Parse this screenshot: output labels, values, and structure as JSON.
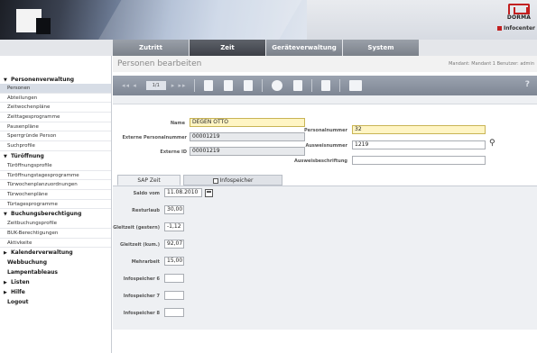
{
  "header": {
    "brand": "DORMA",
    "product": "Infocenter",
    "tabs": [
      "Zutritt",
      "Zeit",
      "Geräteverwaltung",
      "System"
    ],
    "active_tab": "Zeit"
  },
  "page": {
    "title": "Personen bearbeiten",
    "mandant": "Mandant: Mandant 1   Benutzer: admin"
  },
  "toolbar": {
    "nav_prev": "◂◂ ◂",
    "page": "1/1",
    "nav_next": "▸ ▸▸",
    "help": "?"
  },
  "sidebar": {
    "sections": [
      {
        "label": "Personenverwaltung",
        "expanded": true
      },
      {
        "label": "Türöffnung",
        "expanded": true
      },
      {
        "label": "Buchungsberechtigung",
        "expanded": true
      },
      {
        "label": "Kalenderverwaltung",
        "expanded": false
      },
      {
        "label": "Listen",
        "expanded": false
      },
      {
        "label": "Hilfe",
        "expanded": false
      }
    ],
    "personen_items": [
      "Personen",
      "Abteilungen",
      "Zeitwochenpläne",
      "Zeittagesprogramme",
      "Pausenpläne",
      "Sperrgründe Person",
      "Suchprofile"
    ],
    "tuer_items": [
      "Türöffnungsprofile",
      "Türöffnungstagesprogramme",
      "Türwochenplanzuordnungen",
      "Türwochenpläne",
      "Türtagesprogramme"
    ],
    "buchung_items": [
      "Zeitbuchungsprofile",
      "BUK-Berechtigungen",
      "Aktivkeite"
    ],
    "plain_items": [
      "Webbuchung",
      "Lampentableaus",
      "Logout"
    ]
  },
  "form": {
    "name_label": "Name",
    "name_value": "DEGEN OTTO",
    "ext_personalnummer_label": "Externe Personalnummer",
    "ext_personalnummer_value": "00001219",
    "externe_id_label": "Externe ID",
    "externe_id_value": "00001219",
    "personalnummer_label": "Personalnummer",
    "personalnummer_value": "32",
    "ausweisnummer_label": "Ausweisnummer",
    "ausweisnummer_value": "1219",
    "ausweisbeschriftung_label": "Ausweisbeschriftung",
    "ausweisbeschriftung_value": ""
  },
  "subtabs": {
    "sap_zeit": "SAP Zeit",
    "infospeicher": "Infospeicher"
  },
  "saldo": {
    "saldo_vom_label": "Saldo vom",
    "saldo_vom_value": "11.08.2010",
    "resturlaub_label": "Resturlaub",
    "resturlaub_value": "30,00",
    "gleitzeit_gestern_label": "Gleitzeit (gestern)",
    "gleitzeit_gestern_value": "-1,12",
    "gleitzeit_kum_label": "Gleitzeit (kum.)",
    "gleitzeit_kum_value": "92,07",
    "mehrarbeit_label": "Mehrarbeit",
    "mehrarbeit_value": "15,00",
    "info6_label": "Infospeicher 6",
    "info7_label": "Infospeicher 7",
    "info8_label": "Infospeicher 8"
  }
}
